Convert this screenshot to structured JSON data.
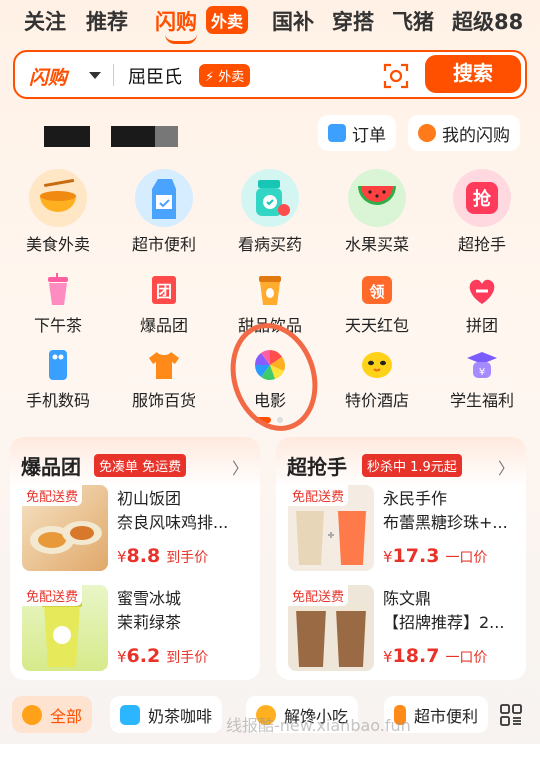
{
  "topnav": {
    "tabs": [
      "关注",
      "推荐",
      "闪购",
      "国补",
      "穿搭",
      "飞猪",
      "超级88"
    ],
    "active_badge": "外卖"
  },
  "search": {
    "logo": "闪购",
    "query": "屈臣氏",
    "tag": "外卖",
    "button": "搜索"
  },
  "user": {
    "orders": "订单",
    "my_flash": "我的闪购"
  },
  "grid_big": [
    {
      "label": "美食外卖",
      "icon": "noodle-bowl-icon"
    },
    {
      "label": "超市便利",
      "icon": "milk-carton-icon"
    },
    {
      "label": "看病买药",
      "icon": "medicine-jar-icon"
    },
    {
      "label": "水果买菜",
      "icon": "watermelon-icon"
    },
    {
      "label": "超抢手",
      "icon": "flash-deal-icon"
    }
  ],
  "grid_small_1": [
    {
      "label": "下午茶",
      "icon": "drink-cup-icon"
    },
    {
      "label": "爆品团",
      "icon": "group-deal-icon"
    },
    {
      "label": "甜品饮品",
      "icon": "coffee-cup-icon"
    },
    {
      "label": "天天红包",
      "icon": "red-envelope-icon"
    },
    {
      "label": "拼团",
      "icon": "team-icon"
    }
  ],
  "grid_small_2": [
    {
      "label": "手机数码",
      "icon": "phone-icon"
    },
    {
      "label": "服饰百货",
      "icon": "tshirt-icon"
    },
    {
      "label": "电影",
      "icon": "film-aperture-icon"
    },
    {
      "label": "特价酒店",
      "icon": "hotel-chick-icon"
    },
    {
      "label": "学生福利",
      "icon": "graduation-cap-icon"
    }
  ],
  "cards": [
    {
      "title": "爆品团",
      "tag": "免凑单 免运费",
      "items": [
        {
          "badge": "免配送费",
          "name": "初山饭团",
          "desc": "奈良风味鸡排...",
          "yen": "¥",
          "price": "8.8",
          "suffix": "到手价"
        },
        {
          "badge": "免配送费",
          "name": "蜜雪冰城",
          "desc": "茉莉绿茶",
          "yen": "¥",
          "price": "6.2",
          "suffix": "到手价"
        }
      ]
    },
    {
      "title": "超抢手",
      "tag": "秒杀中 1.9元起",
      "items": [
        {
          "badge": "免配送费",
          "name": "永民手作",
          "desc": "布蕾黑糖珍珠+...",
          "yen": "¥",
          "price": "17.3",
          "suffix": "一口价"
        },
        {
          "badge": "免配送费",
          "name": "陈文鼎",
          "desc": "【招牌推荐】2...",
          "yen": "¥",
          "price": "18.7",
          "suffix": "一口价"
        }
      ]
    }
  ],
  "chips": [
    "全部",
    "奶茶咖啡",
    "解馋小吃",
    "超市便利"
  ],
  "watermark": "线报酷-new.xianbao.fun",
  "colors": {
    "accent": "#ff5000",
    "price_red": "#e8332a",
    "annotation": "#f26a45"
  }
}
